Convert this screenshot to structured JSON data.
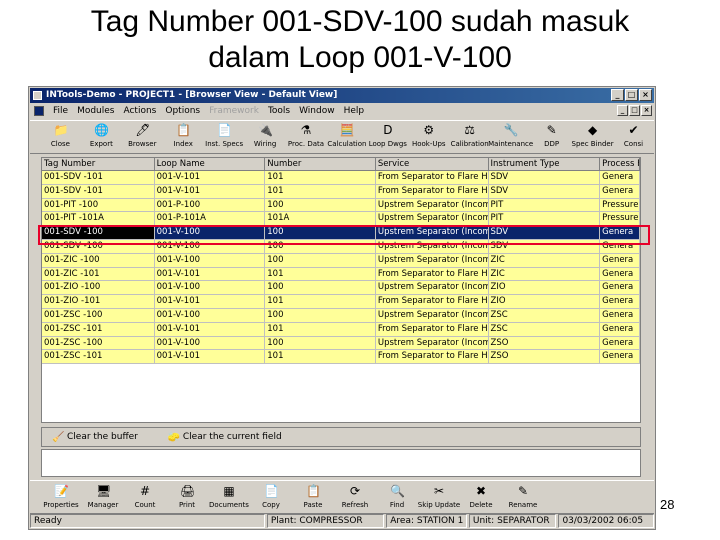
{
  "slide": {
    "title_line1": "Tag Number 001-SDV-100 sudah masuk",
    "title_line2": "dalam Loop 001-V-100",
    "page_number": "28"
  },
  "window": {
    "title": "INTools-Demo - PROJECT1 - [Browser View - Default View]",
    "menu": [
      "File",
      "Modules",
      "Actions",
      "Options",
      "Framework",
      "Tools",
      "Window",
      "Help"
    ],
    "menu_disabled": "Framework"
  },
  "toolbar": [
    {
      "label": "Close",
      "icon": "close-folder-icon",
      "glyph": "📁"
    },
    {
      "label": "Export",
      "icon": "export-icon",
      "glyph": "🌐"
    },
    {
      "label": "Browser",
      "icon": "browser-icon",
      "glyph": "🖊"
    },
    {
      "label": "Index",
      "icon": "index-icon",
      "glyph": "📋"
    },
    {
      "label": "Inst. Specs",
      "icon": "inst-specs-icon",
      "glyph": "📄"
    },
    {
      "label": "Wiring",
      "icon": "wiring-icon",
      "glyph": "🔌"
    },
    {
      "label": "Proc. Data",
      "icon": "proc-data-icon",
      "glyph": "⚗"
    },
    {
      "label": "Calculation",
      "icon": "calculation-icon",
      "glyph": "🧮"
    },
    {
      "label": "Loop Dwgs",
      "icon": "loop-dwgs-icon",
      "glyph": "D"
    },
    {
      "label": "Hook-Ups",
      "icon": "hook-ups-icon",
      "glyph": "⚙"
    },
    {
      "label": "Calibration",
      "icon": "calibration-icon",
      "glyph": "⚖"
    },
    {
      "label": "Maintenance",
      "icon": "maintenance-icon",
      "glyph": "🔧"
    },
    {
      "label": "DDP",
      "icon": "ddp-icon",
      "glyph": "✎"
    },
    {
      "label": "Spec Binder",
      "icon": "spec-binder-icon",
      "glyph": "◆"
    },
    {
      "label": "Consi",
      "icon": "consistency-icon",
      "glyph": "✔"
    }
  ],
  "grid": {
    "columns": [
      "Tag Number",
      "Loop Name",
      "Number",
      "Service",
      "Instrument Type",
      "Process F"
    ],
    "rows": [
      [
        "001-SDV -101",
        "001-V-101",
        "101",
        "From Separator to Flare Ho",
        "SDV",
        "Genera"
      ],
      [
        "001-SDV -101",
        "001-V-101",
        "101",
        "From Separator to Flare He",
        "SDV",
        "Genera"
      ],
      [
        "001-PIT -100",
        "001-P-100",
        "100",
        "Upstrem Separator (Incomii",
        "PIT",
        "Pressure"
      ],
      [
        "001-PIT -101A",
        "001-P-101A",
        "101A",
        "Upstrem Separator (Incomii",
        "PIT",
        "Pressure"
      ],
      [
        "001-SDV -100",
        "001-V-100",
        "100",
        "Upstrem Separator (Incomii",
        "SDV",
        "Genera"
      ],
      [
        "001-SDV -100",
        "001-V-100",
        "100",
        "Upstrem Separator (Incomii",
        "SDV",
        "Genera"
      ],
      [
        "001-ZIC -100",
        "001-V-100",
        "100",
        "Upstrem Separator (Incomii",
        "ZIC",
        "Genera"
      ],
      [
        "001-ZIC -101",
        "001-V-101",
        "101",
        "From Separator to Flare He",
        "ZIC",
        "Genera"
      ],
      [
        "001-ZIO -100",
        "001-V-100",
        "100",
        "Upstrem Separator (Incomii",
        "ZIO",
        "Genera"
      ],
      [
        "001-ZIO -101",
        "001-V-101",
        "101",
        "From Separator to Flare Ho",
        "ZIO",
        "Genera"
      ],
      [
        "001-ZSC -100",
        "001-V-100",
        "100",
        "Upstrem Separator (Incomii",
        "ZSC",
        "Genera"
      ],
      [
        "001-ZSC -101",
        "001-V-101",
        "101",
        "From Separator to Flare He",
        "ZSC",
        "Genera"
      ],
      [
        "001-ZSC -100",
        "001-V-100",
        "100",
        "Upstrem Separator (Incomii",
        "ZSO",
        "Genera"
      ],
      [
        "001-ZSC -101",
        "001-V-101",
        "101",
        "From Separator to Flare He",
        "ZSO",
        "Genera"
      ]
    ],
    "selected_row": 4
  },
  "buffer": {
    "clear_buffer": "Clear the buffer",
    "clear_field": "Clear the current field"
  },
  "bottom_toolbar": [
    {
      "label": "Properties",
      "icon": "properties-icon",
      "glyph": "📝"
    },
    {
      "label": "Manager",
      "icon": "manager-icon",
      "glyph": "🖥"
    },
    {
      "label": "Count",
      "icon": "count-icon",
      "glyph": "#"
    },
    {
      "label": "Print",
      "icon": "print-icon",
      "glyph": "🖨"
    },
    {
      "label": "Documents",
      "icon": "documents-icon",
      "glyph": "▦"
    },
    {
      "label": "Copy",
      "icon": "copy-icon",
      "glyph": "📄"
    },
    {
      "label": "Paste",
      "icon": "paste-icon",
      "glyph": "📋"
    },
    {
      "label": "Refresh",
      "icon": "refresh-icon",
      "glyph": "⟳"
    },
    {
      "label": "Find",
      "icon": "find-icon",
      "glyph": "🔍"
    },
    {
      "label": "Skip Update",
      "icon": "skip-update-icon",
      "glyph": "✂"
    },
    {
      "label": "Delete",
      "icon": "delete-icon",
      "glyph": "✖"
    },
    {
      "label": "Rename",
      "icon": "rename-icon",
      "glyph": "✎"
    }
  ],
  "status": {
    "ready": "Ready",
    "plant": "Plant: COMPRESSOR",
    "area": "Area: STATION 1",
    "unit": "Unit: SEPARATOR",
    "date": "03/03/2002 06:05"
  }
}
